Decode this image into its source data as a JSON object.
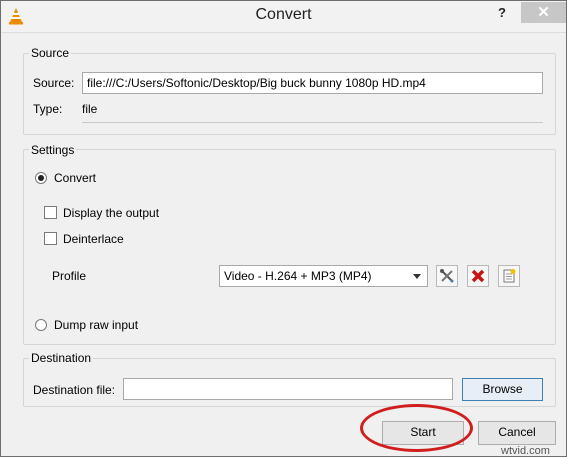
{
  "window": {
    "title": "Convert",
    "help_label": "?",
    "close_label": "✕"
  },
  "source": {
    "group_title": "Source",
    "source_label": "Source:",
    "source_value": "file:///C:/Users/Softonic/Desktop/Big buck bunny 1080p HD.mp4",
    "type_label": "Type:",
    "type_value": "file"
  },
  "settings": {
    "group_title": "Settings",
    "convert_label": "Convert",
    "convert_checked": true,
    "display_output_label": "Display the output",
    "display_output_checked": false,
    "deinterlace_label": "Deinterlace",
    "deinterlace_checked": false,
    "profile_label": "Profile",
    "profile_value": "Video - H.264 + MP3 (MP4)",
    "dump_raw_label": "Dump raw input",
    "dump_raw_checked": false
  },
  "destination": {
    "group_title": "Destination",
    "file_label": "Destination file:",
    "file_value": "",
    "browse_label": "Browse"
  },
  "buttons": {
    "start_label": "Start",
    "cancel_label": "Cancel"
  },
  "watermark": "wtvid.com",
  "colors": {
    "highlight_ring": "#d01d1d",
    "delete_profile_red": "#c81414",
    "vlc_orange": "#f08a00"
  }
}
